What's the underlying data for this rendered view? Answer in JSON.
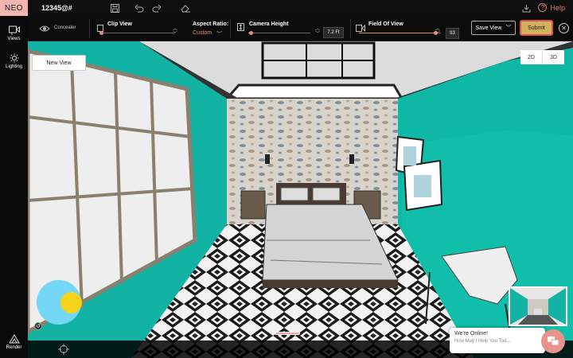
{
  "app": {
    "logo": "NEO",
    "project_name": "12345@#"
  },
  "topbar": {
    "help_label": "Help"
  },
  "toolbar": {
    "concealer_label": "Concealer",
    "clip_view": {
      "label": "Clip View",
      "value_fraction": 0.02
    },
    "aspect_ratio": {
      "label": "Aspect Ratio:",
      "value": "Custom"
    },
    "camera_height": {
      "label": "Camera Height",
      "value": "7.2 Ft",
      "value_fraction": 0.04
    },
    "field_of_view": {
      "label": "Field Of View",
      "value": "93",
      "value_fraction": 0.93
    },
    "save_view_label": "Save View",
    "submit_label": "Submit"
  },
  "sidebar": {
    "items": [
      {
        "label": "Views",
        "icon": "camera-icon"
      },
      {
        "label": "Lighting",
        "icon": "sun-icon"
      },
      {
        "label": "Render",
        "icon": "render-icon"
      }
    ]
  },
  "viewport": {
    "new_view_label": "New View",
    "mode_2d": "2D",
    "mode_3d": "3D",
    "colors": {
      "wall": "#12b3a5",
      "accent": "#e48a82",
      "submit": "#d2b15a",
      "sun": "#f6d31b",
      "sky": "#73d7f5"
    }
  },
  "chat": {
    "title": "We're Online!",
    "subtitle": "How May I Help You Tod..."
  }
}
